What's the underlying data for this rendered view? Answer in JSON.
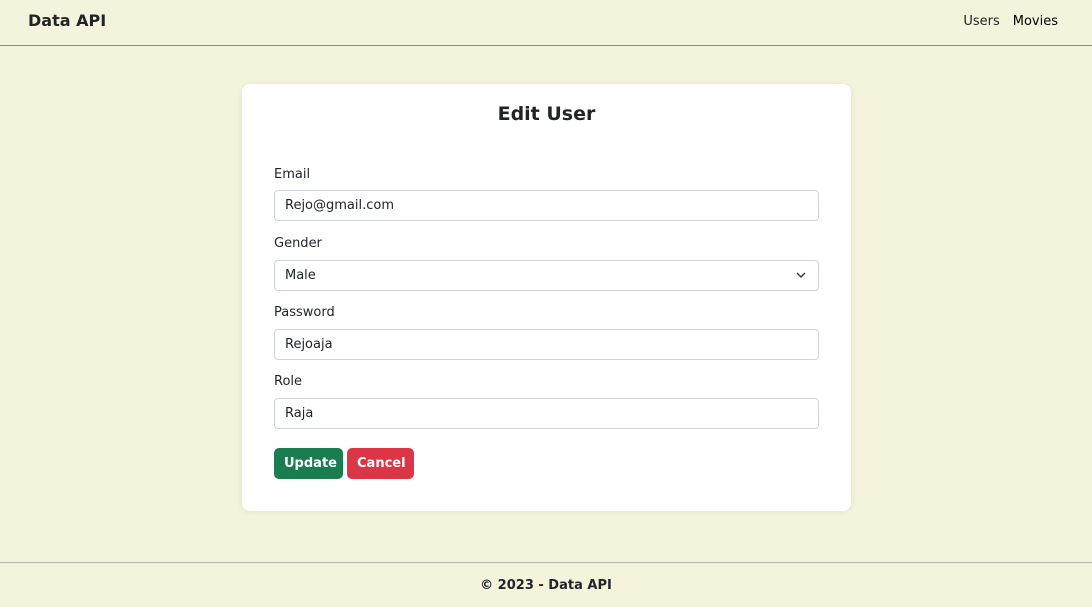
{
  "navbar": {
    "brand": "Data API",
    "links": [
      {
        "label": "Users"
      },
      {
        "label": "Movies"
      }
    ]
  },
  "form": {
    "title": "Edit User",
    "email": {
      "label": "Email",
      "value": "Rejo@gmail.com"
    },
    "gender": {
      "label": "Gender",
      "value": "Male"
    },
    "password": {
      "label": "Password",
      "value": "Rejoaja"
    },
    "role": {
      "label": "Role",
      "value": "Raja"
    },
    "update_label": "Update",
    "cancel_label": "Cancel"
  },
  "footer": {
    "text": "© 2023 - Data API"
  },
  "colors": {
    "background": "#f4f4dc",
    "update_button": "#1a7d4f",
    "cancel_button": "#dc3545"
  }
}
